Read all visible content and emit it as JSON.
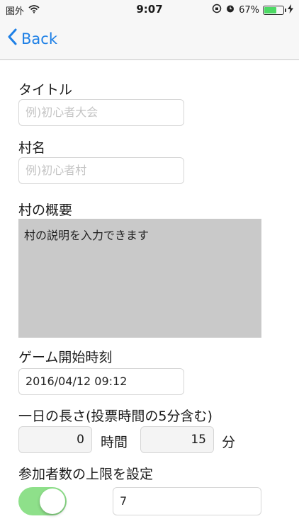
{
  "status_bar": {
    "carrier": "圏外",
    "time": "9:07",
    "battery_percent_label": "67%",
    "battery_level": 0.67
  },
  "nav": {
    "back_label": "Back"
  },
  "form": {
    "title_label": "タイトル",
    "title_placeholder": "例)初心者大会",
    "village_label": "村名",
    "village_placeholder": "例)初心者村",
    "summary_label": "村の概要",
    "summary_text": "村の説明を入力できます",
    "start_label": "ゲーム開始時刻",
    "start_value": "2016/04/12 09:12",
    "day_length_label": "一日の長さ(投票時間の5分含む)",
    "hours_value": "0",
    "hours_unit": "時間",
    "minutes_value": "15",
    "minutes_unit": "分",
    "max_players_label": "参加者数の上限を設定",
    "max_players_enabled": true,
    "max_players_value": "7"
  },
  "colors": {
    "accent": "#1e80e6",
    "toggle_on": "#8ee08a",
    "textarea_bg": "#c9c9c9"
  }
}
